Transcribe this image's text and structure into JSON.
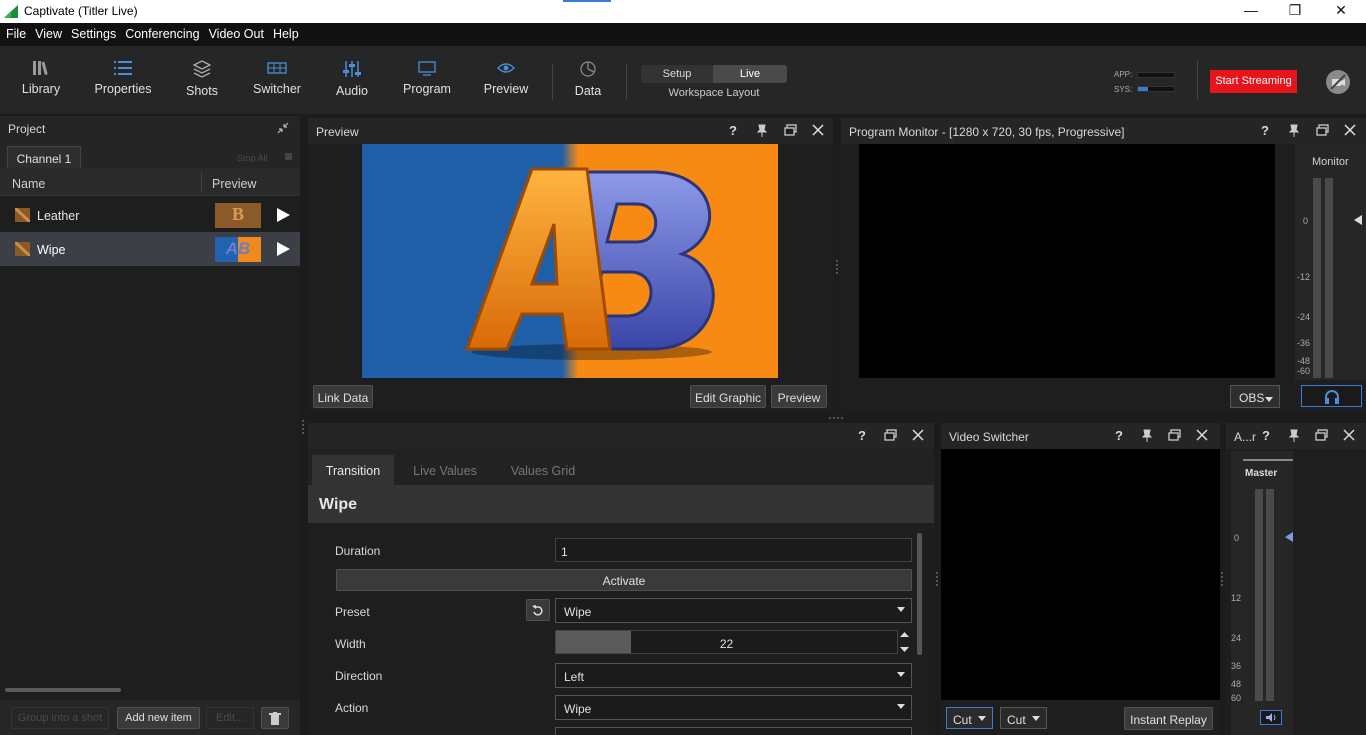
{
  "window": {
    "title": "Captivate (Titler Live)",
    "minimize": "—",
    "restore": "❐",
    "close": "✕"
  },
  "menu": [
    "File",
    "View",
    "Settings",
    "Conferencing",
    "Video Out",
    "Help"
  ],
  "toolbar": {
    "items": [
      "Library",
      "Properties",
      "Shots",
      "Switcher",
      "Audio",
      "Program",
      "Preview",
      "Data"
    ],
    "workspace": {
      "setup": "Setup",
      "live": "Live",
      "caption": "Workspace Layout"
    },
    "meters": {
      "app": "APP:",
      "sys": "SYS:"
    },
    "start_streaming": "Start Streaming"
  },
  "project": {
    "title": "Project",
    "tab": "Channel 1",
    "stop_all": "Stop All",
    "columns": {
      "name": "Name",
      "preview": "Preview"
    },
    "items": [
      {
        "name": "Leather",
        "thumb": "B"
      },
      {
        "name": "Wipe",
        "thumb": "AB"
      }
    ],
    "buttons": {
      "group": "Group into a shot",
      "add": "Add new item",
      "edit": "Edit..."
    }
  },
  "preview": {
    "title": "Preview",
    "help": "?",
    "buttons": {
      "link": "Link Data",
      "edit": "Edit Graphic",
      "preview": "Preview"
    },
    "graphic": {
      "left_color": "#1f5fa8",
      "right_color": "#f68a12"
    }
  },
  "program": {
    "title": "Program Monitor - [1280 x 720, 30 fps, Progressive]",
    "monitor_label": "Monitor",
    "scale": [
      "0",
      "-12",
      "-24",
      "-36",
      "-48",
      "-60"
    ],
    "output": "OBS"
  },
  "transition": {
    "tabs": [
      "Transition",
      "Live Values",
      "Values Grid"
    ],
    "heading": "Wipe",
    "fields": {
      "duration_label": "Duration",
      "duration_value": "1",
      "activate": "Activate",
      "preset_label": "Preset",
      "preset_value": "Wipe",
      "width_label": "Width",
      "width_value": "22",
      "width_fill": 0.22,
      "direction_label": "Direction",
      "direction_value": "Left",
      "action_label": "Action",
      "action_value": "Wipe"
    }
  },
  "video_switcher": {
    "title": "Video Switcher",
    "cut1": "Cut",
    "cut2": "Cut",
    "instant_replay": "Instant Replay"
  },
  "audio": {
    "title": "A...r",
    "master": "Master",
    "scale": [
      "0",
      "12",
      "24",
      "36",
      "48",
      "60"
    ]
  }
}
